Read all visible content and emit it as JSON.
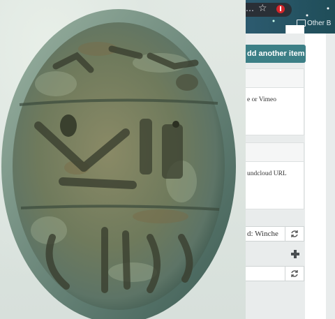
{
  "browser": {
    "bookmarks_label": "Other B",
    "icons": [
      "star-icon",
      "extension-icon",
      "folder-icon"
    ]
  },
  "page": {
    "add_item_label": "dd another item",
    "card1_text": "e or Vimeo",
    "card2_text": "undcloud URL",
    "input1_value": "d: Winche",
    "colors": {
      "accent": "#3c7f86",
      "background": "#e9ecec"
    }
  },
  "photo": {
    "subject": "scarab seal",
    "icon": "scarab-seal-photo"
  }
}
